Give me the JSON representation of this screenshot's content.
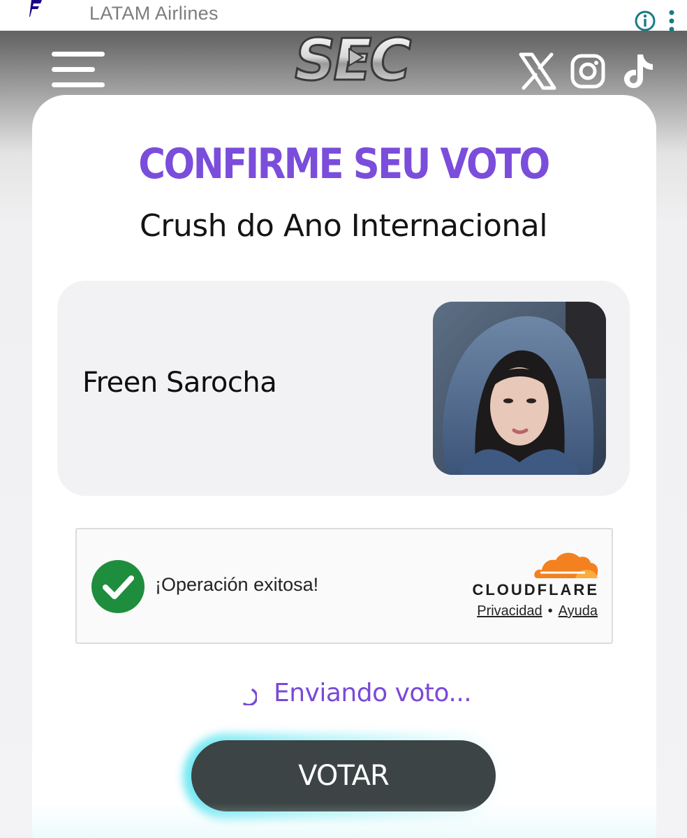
{
  "ad_bar": {
    "title": "LATAM Airlines",
    "info_icon": "info-circle-icon",
    "more_icon": "kebab-menu-icon"
  },
  "header": {
    "menu_icon": "hamburger-menu-icon",
    "logo_text": "SEC AWARDS",
    "social": [
      "x-icon",
      "instagram-icon",
      "tiktok-icon"
    ]
  },
  "main": {
    "title": "CONFIRME SEU VOTO",
    "category": "Crush do Ano Internacional",
    "nominee": {
      "name": "Freen Sarocha",
      "photo": "nominee-photo"
    }
  },
  "captcha": {
    "status_text": "¡Operación exitosa!",
    "brand": "CLOUDFLARE",
    "privacy_label": "Privacidad",
    "separator": "•",
    "help_label": "Ayuda"
  },
  "status": {
    "sending_text": "Enviando voto..."
  },
  "vote_button": {
    "label": "VOTAR"
  },
  "colors": {
    "accent_purple": "#7b4ddb",
    "success_green": "#1e8e3e",
    "cloudflare_orange": "#f48120",
    "button_dark": "#3c4445",
    "button_glow": "#56e3f0"
  }
}
